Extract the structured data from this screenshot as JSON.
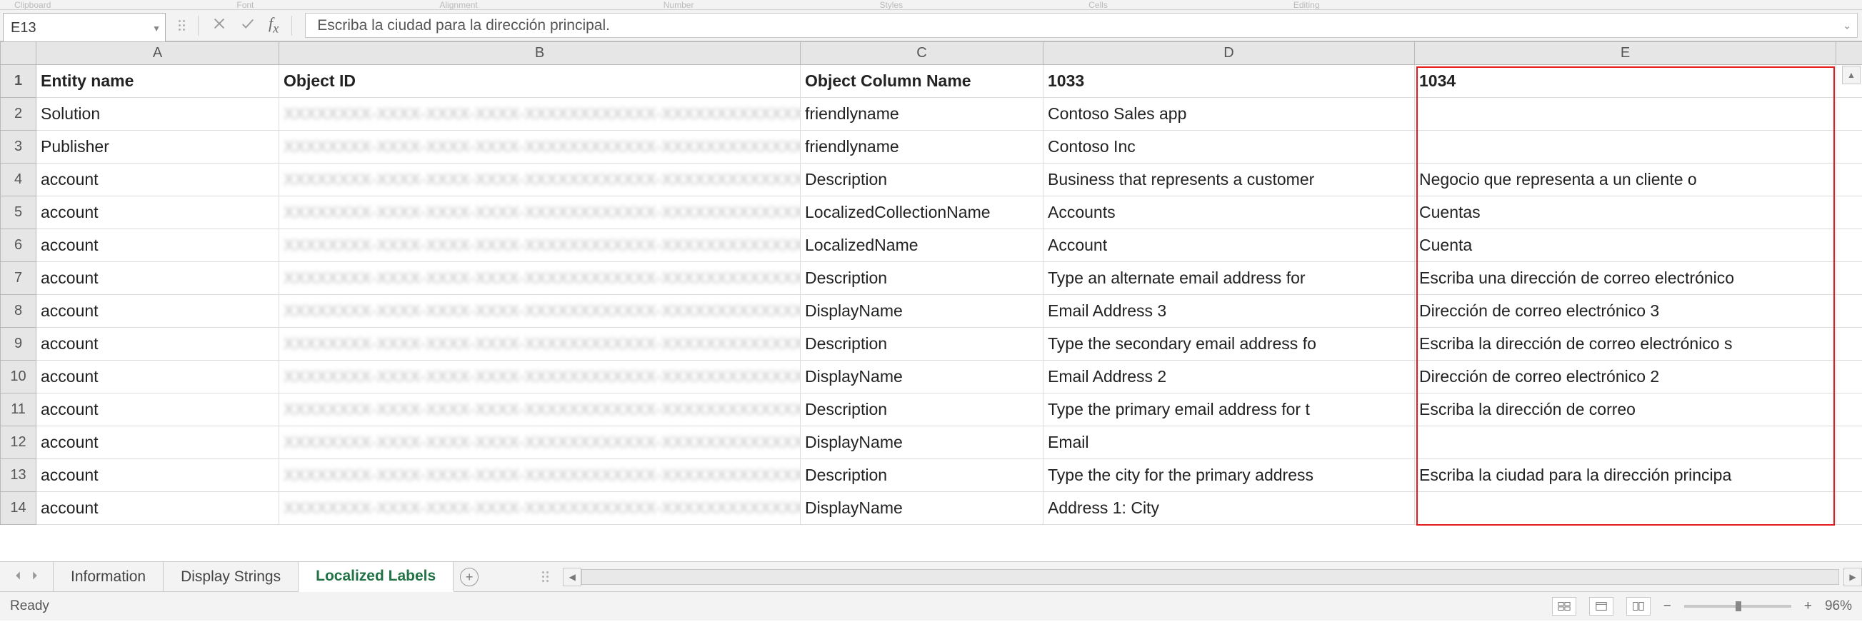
{
  "ribbon_groups": [
    "Clipboard",
    "Font",
    "Alignment",
    "Number",
    "Styles",
    "Cells",
    "Editing"
  ],
  "name_box": {
    "value": "E13"
  },
  "formula_bar": {
    "value": "Escriba la ciudad para la dirección principal."
  },
  "columns": [
    "A",
    "B",
    "C",
    "D",
    "E"
  ],
  "rows": [
    {
      "n": 1,
      "A": "Entity name",
      "B": "Object ID",
      "C": "Object Column Name",
      "D": "1033",
      "E": "1034"
    },
    {
      "n": 2,
      "A": "Solution",
      "B": "",
      "C": "friendlyname",
      "D": "Contoso Sales app",
      "E": ""
    },
    {
      "n": 3,
      "A": "Publisher",
      "B": "",
      "C": "friendlyname",
      "D": "Contoso Inc",
      "E": ""
    },
    {
      "n": 4,
      "A": "account",
      "B": "",
      "C": "Description",
      "D": "Business that represents a customer",
      "E": "Negocio que representa a un cliente o"
    },
    {
      "n": 5,
      "A": "account",
      "B": "",
      "C": "LocalizedCollectionName",
      "D": "Accounts",
      "E": "Cuentas"
    },
    {
      "n": 6,
      "A": "account",
      "B": "",
      "C": "LocalizedName",
      "D": "Account",
      "E": "Cuenta"
    },
    {
      "n": 7,
      "A": "account",
      "B": "",
      "C": "Description",
      "D": "Type an alternate email address for",
      "E": "Escriba una dirección de correo electrónico"
    },
    {
      "n": 8,
      "A": "account",
      "B": "",
      "C": "DisplayName",
      "D": "Email Address 3",
      "E": "Dirección de correo electrónico 3"
    },
    {
      "n": 9,
      "A": "account",
      "B": "",
      "C": "Description",
      "D": "Type the secondary email address fo",
      "E": "Escriba la dirección de correo electrónico s"
    },
    {
      "n": 10,
      "A": "account",
      "B": "",
      "C": "DisplayName",
      "D": "Email Address 2",
      "E": "Dirección de correo electrónico 2"
    },
    {
      "n": 11,
      "A": "account",
      "B": "",
      "C": "Description",
      "D": "Type the primary email address for t",
      "E": "Escriba la dirección de correo"
    },
    {
      "n": 12,
      "A": "account",
      "B": "",
      "C": "DisplayName",
      "D": "Email",
      "E": ""
    },
    {
      "n": 13,
      "A": "account",
      "B": "",
      "C": "Description",
      "D": "Type the city for the primary address",
      "E": "Escriba la ciudad para la dirección principa"
    },
    {
      "n": 14,
      "A": "account",
      "B": "",
      "C": "DisplayName",
      "D": "Address 1: City",
      "E": ""
    }
  ],
  "tabs": [
    {
      "label": "Information",
      "active": false
    },
    {
      "label": "Display Strings",
      "active": false
    },
    {
      "label": "Localized Labels",
      "active": true
    }
  ],
  "status": {
    "left": "Ready",
    "zoom": "96%"
  }
}
